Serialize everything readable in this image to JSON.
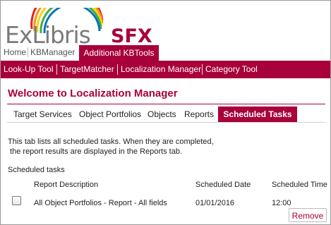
{
  "branding": {
    "name": "ExLibris",
    "product": "SFX"
  },
  "top_nav": {
    "items": [
      "Home",
      "KBManager"
    ],
    "active": "Additional KBTools"
  },
  "sub_nav": {
    "items": [
      "Look-Up Tool",
      "TargetMatcher",
      "Localization Manager",
      "Category Tool"
    ]
  },
  "page": {
    "title": "Welcome to Localization Manager"
  },
  "tabs": {
    "items": [
      "Target Services",
      "Object Portfolios",
      "Objects",
      "Reports"
    ],
    "active": "Scheduled Tasks"
  },
  "info": {
    "line1": "This tab lists all scheduled tasks. When they are completed,",
    "line2": " the report results are displayed in the Reports tab."
  },
  "scheduled": {
    "label": "Scheduled tasks",
    "headers": {
      "description": "Report Description",
      "date": "Scheduled Date",
      "time": "Scheduled Time"
    },
    "rows": [
      {
        "checked": false,
        "description": "All Object Portfolios - Report - All fields",
        "date": "01/01/2016",
        "time": "12:00"
      }
    ],
    "remove_label": "Remove"
  },
  "colors": {
    "brand": "#a8003a",
    "logo_gray": "#7a7a7a"
  }
}
